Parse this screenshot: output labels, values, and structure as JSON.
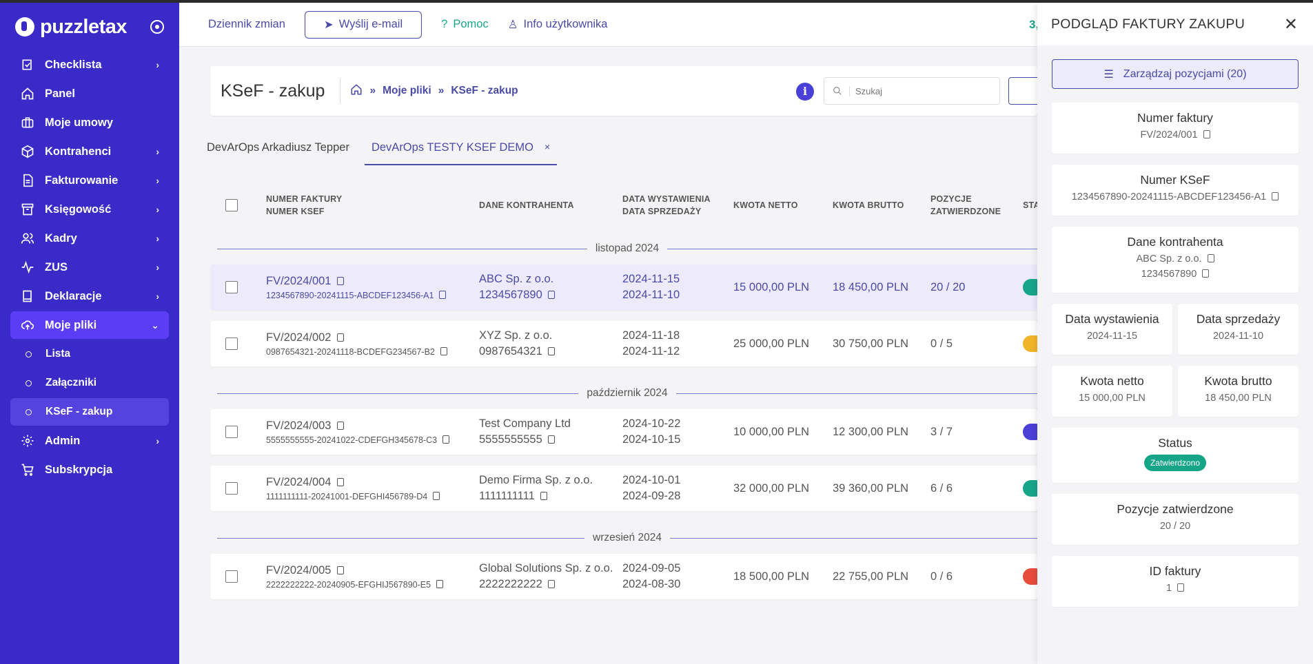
{
  "app": {
    "logo_text": "puzzletax"
  },
  "sidebar": {
    "items": [
      {
        "label": "Checklista",
        "icon": "checklist-icon",
        "chev": "›"
      },
      {
        "label": "Panel",
        "icon": "home-icon",
        "chev": ""
      },
      {
        "label": "Moje umowy",
        "icon": "briefcase-icon",
        "chev": ""
      },
      {
        "label": "Kontrahenci",
        "icon": "box-icon",
        "chev": "›"
      },
      {
        "label": "Fakturowanie",
        "icon": "document-icon",
        "chev": "›"
      },
      {
        "label": "Księgowość",
        "icon": "archive-icon",
        "chev": "›"
      },
      {
        "label": "Kadry",
        "icon": "users-icon",
        "chev": "›"
      },
      {
        "label": "ZUS",
        "icon": "activity-icon",
        "chev": "›"
      },
      {
        "label": "Deklaracje",
        "icon": "book-icon",
        "chev": "›"
      },
      {
        "label": "Moje pliki",
        "icon": "cloud-upload-icon",
        "chev": "⌄"
      }
    ],
    "sub_items": [
      {
        "label": "Lista"
      },
      {
        "label": "Załączniki"
      },
      {
        "label": "KSeF - zakup"
      }
    ],
    "bottom_items": [
      {
        "label": "Admin",
        "chev": "›"
      },
      {
        "label": "Subskrypcja",
        "chev": ""
      }
    ]
  },
  "topnav": {
    "changelog": "Dziennik zmian",
    "send_email": "Wyślij e-mail",
    "help": "Pomoc",
    "user_info": "Info użytkownika",
    "amount": "3,"
  },
  "page": {
    "title": "KSeF - zakup",
    "breadcrumb": [
      "Moje pliki",
      "KSeF - zakup"
    ],
    "search_placeholder": "Szukaj"
  },
  "tabs": [
    {
      "label": "DevArOps Arkadiusz Tepper"
    },
    {
      "label": "DevArOps TESTY KSEF DEMO",
      "close": "×"
    }
  ],
  "table": {
    "headers": {
      "invoice_1": "NUMER FAKTURY",
      "invoice_2": "NUMER KSEF",
      "contractor": "DANE KONTRAHENTA",
      "date_1": "DATA WYSTAWIENIA",
      "date_2": "DATA SPRZEDAŻY",
      "net": "KWOTA NETTO",
      "gross": "KWOTA BRUTTO",
      "positions_1": "POZYCJE",
      "positions_2": "ZATWIERDZONE",
      "status": "STA"
    },
    "groups": [
      {
        "label": "listopad 2024",
        "rows": [
          {
            "inv": "FV/2024/001",
            "ksef": "1234567890-20241115-ABCDEF123456-A1",
            "kname": "ABC Sp. z o.o.",
            "knip": "1234567890",
            "issue": "2024-11-15",
            "sale": "2024-11-10",
            "net": "15 000,00 PLN",
            "gross": "18 450,00 PLN",
            "pos": "20 / 20",
            "status_color": "#17a589",
            "selected": true
          },
          {
            "inv": "FV/2024/002",
            "ksef": "0987654321-20241118-BCDEFG234567-B2",
            "kname": "XYZ Sp. z o.o.",
            "knip": "0987654321",
            "issue": "2024-11-18",
            "sale": "2024-11-12",
            "net": "25 000,00 PLN",
            "gross": "30 750,00 PLN",
            "pos": "0 / 5",
            "status_color": "#f0b429"
          }
        ]
      },
      {
        "label": "październik 2024",
        "rows": [
          {
            "inv": "FV/2024/003",
            "ksef": "5555555555-20241022-CDEFGH345678-C3",
            "kname": "Test Company Ltd",
            "knip": "5555555555",
            "issue": "2024-10-22",
            "sale": "2024-10-15",
            "net": "10 000,00 PLN",
            "gross": "12 300,00 PLN",
            "pos": "3 / 7",
            "status_color": "#4a3fd6"
          },
          {
            "inv": "FV/2024/004",
            "ksef": "1111111111-20241001-DEFGHI456789-D4",
            "kname": "Demo Firma Sp. z o.o.",
            "knip": "1111111111",
            "issue": "2024-10-01",
            "sale": "2024-09-28",
            "net": "32 000,00 PLN",
            "gross": "39 360,00 PLN",
            "pos": "6 / 6",
            "status_color": "#17a589"
          }
        ]
      },
      {
        "label": "wrzesień 2024",
        "rows": [
          {
            "inv": "FV/2024/005",
            "ksef": "2222222222-20240905-EFGHIJ567890-E5",
            "kname": "Global Solutions Sp. z o.o.",
            "knip": "2222222222",
            "issue": "2024-09-05",
            "sale": "2024-08-30",
            "net": "18 500,00 PLN",
            "gross": "22 755,00 PLN",
            "pos": "0 / 6",
            "status_color": "#e74c3c"
          }
        ]
      }
    ]
  },
  "panel": {
    "title": "PODGLĄD FAKTURY ZAKUPU",
    "manage_label": "Zarządzaj pozycjami (20)",
    "invoice_no_label": "Numer faktury",
    "invoice_no": "FV/2024/001",
    "ksef_label": "Numer KSeF",
    "ksef": "1234567890-20241115-ABCDEF123456-A1",
    "contractor_label": "Dane kontrahenta",
    "contractor_name": "ABC Sp. z o.o.",
    "contractor_nip": "1234567890",
    "issue_label": "Data wystawienia",
    "issue": "2024-11-15",
    "sale_label": "Data sprzedaży",
    "sale": "2024-11-10",
    "net_label": "Kwota netto",
    "net": "15 000,00 PLN",
    "gross_label": "Kwota brutto",
    "gross": "18 450,00 PLN",
    "status_label": "Status",
    "status": "Zatwierdzono",
    "positions_label": "Pozycje zatwierdzone",
    "positions": "20 / 20",
    "id_label": "ID faktury",
    "id": "1"
  }
}
